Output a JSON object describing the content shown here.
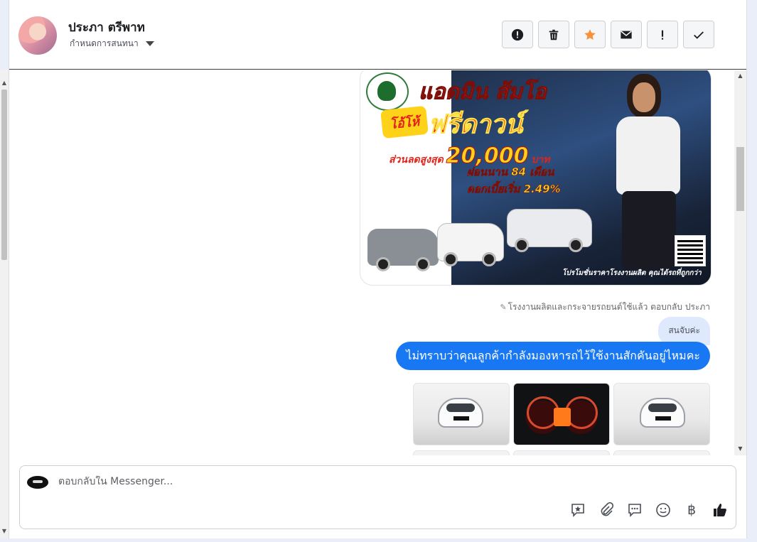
{
  "contact": {
    "name": "ประภา ตรีพาท",
    "settings_label": "กำหนดการสนทนา"
  },
  "actions": [
    {
      "name": "report-button",
      "icon": "alert-circle-icon"
    },
    {
      "name": "delete-button",
      "icon": "trash-icon"
    },
    {
      "name": "star-button",
      "icon": "star-icon",
      "color": "#f7923a"
    },
    {
      "name": "mark-unread-button",
      "icon": "envelope-icon"
    },
    {
      "name": "important-button",
      "icon": "exclamation-icon"
    },
    {
      "name": "done-button",
      "icon": "check-icon"
    }
  ],
  "promo": {
    "title_line1": "แอดมิน ส้มโอ",
    "title_line2": "ฟรีดาวน์",
    "burst": "โอ้โห้",
    "discount_label": "ส่วนลดสูงสุด",
    "discount_value": "20,000",
    "discount_unit": "บาท",
    "installment": "ผ่อนนาน 84 เดือน",
    "interest": "ดอกเบี้ยเริ่ม 2.49%",
    "footer": "โปรโมชั่นราคาโรงงานผลิต คุณได้รถที่ถูกกว่า"
  },
  "thread": {
    "reply_meta": "โรงงานผลิตและกระจายรถยนต์ใช้แล้ว ตอบกลับ ประภา",
    "quoted_reply": "สนจับค่ะ",
    "message": "ไม่ทราบว่าคุณลูกค้ากำลังมองหารถไว้ใช้งานสักคันอยู่ไหมคะ"
  },
  "composer": {
    "placeholder": "ตอบกลับใน Messenger..."
  },
  "colors": {
    "accent": "#1877f2",
    "reply_bg": "#dfe9fd"
  }
}
